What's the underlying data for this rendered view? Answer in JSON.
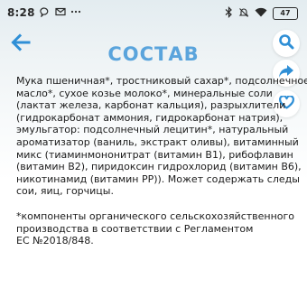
{
  "status_bar": {
    "time": "8:28",
    "battery": "47"
  },
  "header": {
    "title": "СОСТАВ"
  },
  "icons": {
    "back": "arrow-left-icon",
    "search": "search-icon",
    "share": "share-icon",
    "favorite": "heart-icon"
  },
  "colors": {
    "accent": "#2f8fd6",
    "title": "#5aa4dc"
  },
  "composition": {
    "lines": [
      "Мука пшеничная*, тростниковый сахар*, подсолнечное",
      "масло*, сухое козье молоко*, минеральные соли",
      "(лактат железа, карбонат кальция), разрыхлители",
      "(гидрокарбонат аммония, гидрокарбонат натрия),",
      "эмульгатор: подсолнечный лецитин*, натуральный",
      "ароматизатор (ваниль, экстракт оливы), витаминный",
      "микс (тиаминмононитрат (витамин B1), рибофлавин",
      "(витамин B2), пиридоксин гидрохлорид (витамин B6),",
      "никотинамид (витамин PP)). Может содержать следы",
      "сои, яиц, горчицы."
    ],
    "footnote_lines": [
      "*компоненты органического сельскохозяйственного",
      "производства в соответствии с Регламентом",
      "ЕС №2018/848."
    ]
  }
}
